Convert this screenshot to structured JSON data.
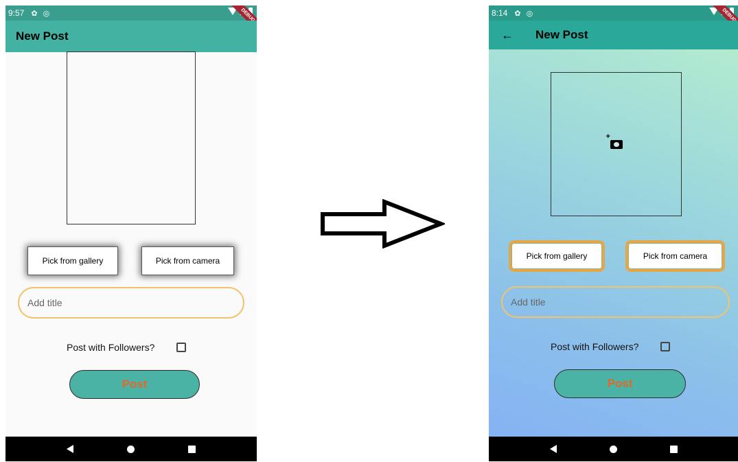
{
  "left_screen": {
    "status": {
      "time": "9:57"
    },
    "appbar": {
      "title": "New Post"
    },
    "buttons": {
      "gallery": "Pick from gallery",
      "camera": "Pick from camera"
    },
    "title_input": {
      "placeholder": "Add title"
    },
    "followers": {
      "label": "Post with Followers?",
      "checked": false
    },
    "post_button": "Post",
    "colors": {
      "appbar": "#44b2a2",
      "statusbar": "#3a9e8e",
      "post_text": "#e06a29"
    }
  },
  "right_screen": {
    "status": {
      "time": "8:14"
    },
    "appbar": {
      "title": "New Post"
    },
    "buttons": {
      "gallery": "Pick from gallery",
      "camera": "Pick from camera"
    },
    "title_input": {
      "placeholder": "Add title"
    },
    "followers": {
      "label": "Post with Followers?",
      "checked": false
    },
    "post_button": "Post",
    "colors": {
      "appbar": "#2aa899",
      "gradient_top": "#b9f0cc",
      "gradient_bottom": "#84b0f6",
      "button_border": "#e5a64a"
    }
  },
  "icons": [
    "settings-icon",
    "sync-icon",
    "wifi-icon",
    "signal-icon",
    "battery-icon",
    "back-arrow-icon",
    "add-camera-icon",
    "nav-back-icon",
    "nav-home-icon",
    "nav-recents-icon",
    "transition-arrow-icon"
  ]
}
